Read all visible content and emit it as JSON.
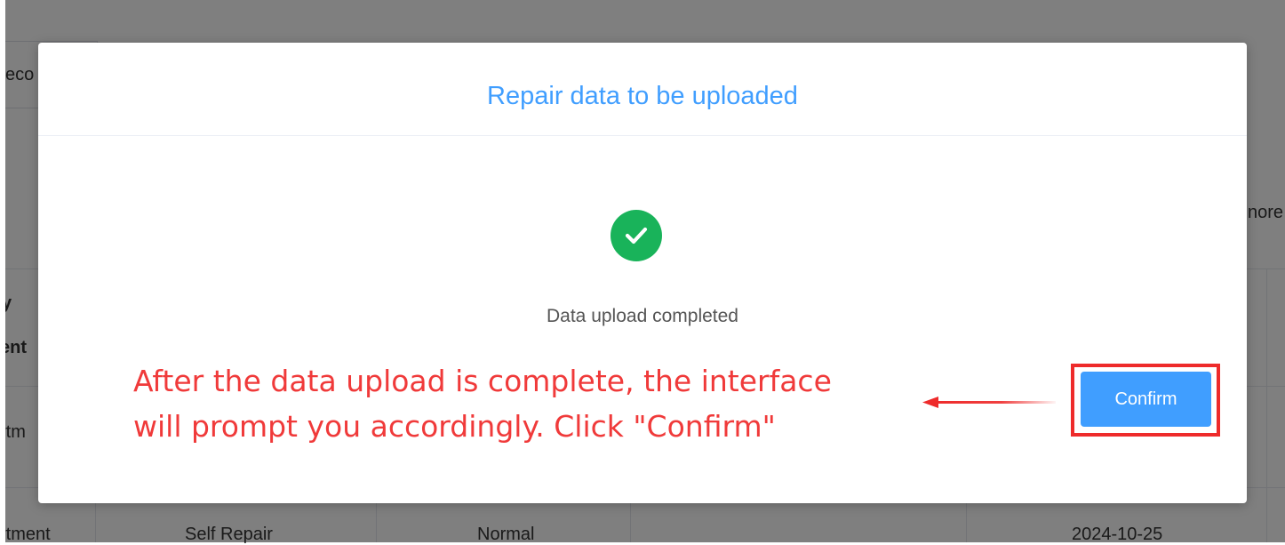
{
  "background": {
    "tab_fragment": "eco",
    "more_fragment": "nore",
    "header_fragment_1": "y",
    "header_fragment_2": "ent",
    "row1_fragment": "rtm",
    "row2": {
      "department": "rtment",
      "type": "Self Repair",
      "priority": "Normal",
      "date": "2024-10-25"
    }
  },
  "dialog": {
    "title": "Repair data to be uploaded",
    "status_icon": "check-circle-icon",
    "status_text": "Data upload completed",
    "confirm_label": "Confirm"
  },
  "annotation": {
    "line1": "After the data upload is complete, the interface",
    "line2": "will prompt you accordingly. Click \"Confirm\"",
    "color": "#f03a3a"
  },
  "colors": {
    "accent": "#409eff",
    "success": "#19b35a",
    "highlight": "#ee2b2b"
  }
}
